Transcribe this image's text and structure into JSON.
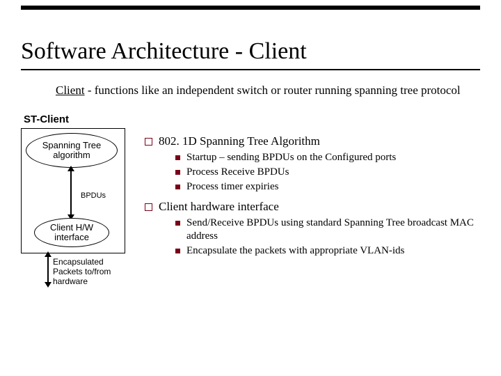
{
  "title": "Software Architecture - Client",
  "subtitle": {
    "lead": "Client",
    "rest": " - functions like an independent switch or router running spanning tree protocol"
  },
  "diagram": {
    "box_label": "ST-Client",
    "spanning_label": "Spanning Tree algorithm",
    "bpdus_label": "BPDUs",
    "hw_label": "Client H/W interface",
    "encap_label": "Encapsulated Packets to/from hardware"
  },
  "points": [
    {
      "heading": "802. 1D Spanning Tree Algorithm",
      "subs": [
        "Startup – sending BPDUs on the Configured ports",
        "Process Receive BPDUs",
        "Process timer expiries"
      ]
    },
    {
      "heading": "Client hardware interface",
      "subs": [
        "Send/Receive BPDUs using standard Spanning Tree broadcast MAC address",
        "Encapsulate the packets with appropriate VLAN-ids"
      ]
    }
  ]
}
